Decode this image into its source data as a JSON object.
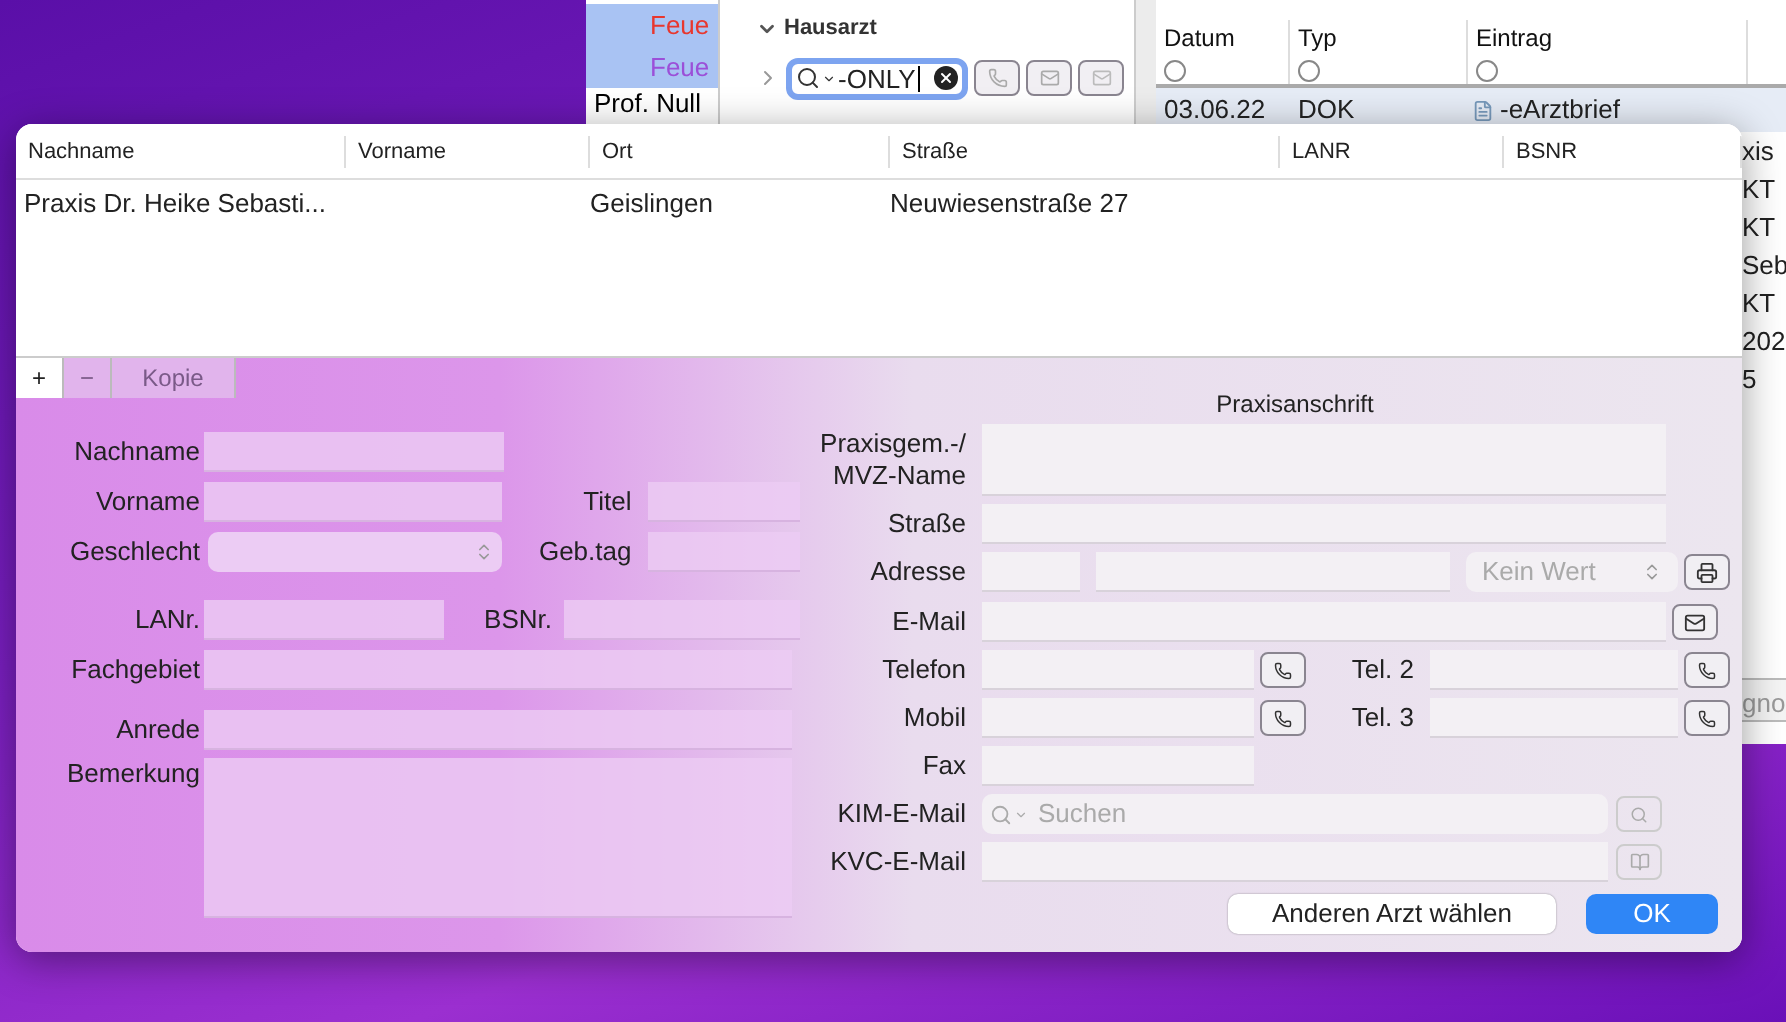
{
  "background_window": {
    "list_items": [
      {
        "text": "Feue",
        "color": "#e8372e",
        "selected": true
      },
      {
        "text": "Feue",
        "color": "#9b4fd8",
        "selected": true
      },
      {
        "text": "Prof. Null",
        "color": "#000000",
        "selected": false
      }
    ],
    "section": {
      "title": "Hausarzt",
      "expanded": true
    },
    "search": {
      "value": "-ONLY"
    },
    "journal": {
      "columns": [
        "Datum",
        "Typ",
        "Eintrag"
      ],
      "row": {
        "date": "03.06.22",
        "type": "DOK",
        "entry": "-eArztbrief"
      },
      "side_texts": [
        "xis",
        "KT",
        "KT",
        "Seb",
        "KT",
        "202",
        "5"
      ],
      "lower_text": "gno"
    }
  },
  "dialog": {
    "table": {
      "columns": [
        "Nachname",
        "Vorname",
        "Ort",
        "Straße",
        "LANR",
        "BSNR"
      ],
      "rows": [
        {
          "nachname": "Praxis Dr. Heike Sebasti...",
          "ort": "Geislingen",
          "strasse": "Neuwiesenstraße 27"
        }
      ]
    },
    "toolbar": [
      {
        "label": "+",
        "disabled": false
      },
      {
        "label": "−",
        "disabled": true
      },
      {
        "label": "Kopie",
        "disabled": true
      }
    ],
    "person": {
      "nachname": "Nachname",
      "vorname": "Vorname",
      "titel": "Titel",
      "geschlecht": "Geschlecht",
      "gebtag": "Geb.tag",
      "lanr": "LANr.",
      "bsnr": "BSNr.",
      "fachgebiet": "Fachgebiet",
      "anrede": "Anrede",
      "bemerkung": "Bemerkung"
    },
    "address": {
      "title": "Praxisanschrift",
      "praxis": "Praxisgem.-/ MVZ-Name",
      "strasse": "Straße",
      "adresse": "Adresse",
      "land_placeholder": "Kein Wert",
      "email": "E-Mail",
      "telefon": "Telefon",
      "tel2": "Tel. 2",
      "mobil": "Mobil",
      "tel3": "Tel. 3",
      "fax": "Fax",
      "kim": "KIM-E-Mail",
      "kim_placeholder": "Suchen",
      "kvc": "KVC-E-Mail"
    },
    "buttons": [
      {
        "label": "Anderen Arzt wählen",
        "kind": "secondary"
      },
      {
        "label": "OK",
        "kind": "primary"
      }
    ]
  }
}
